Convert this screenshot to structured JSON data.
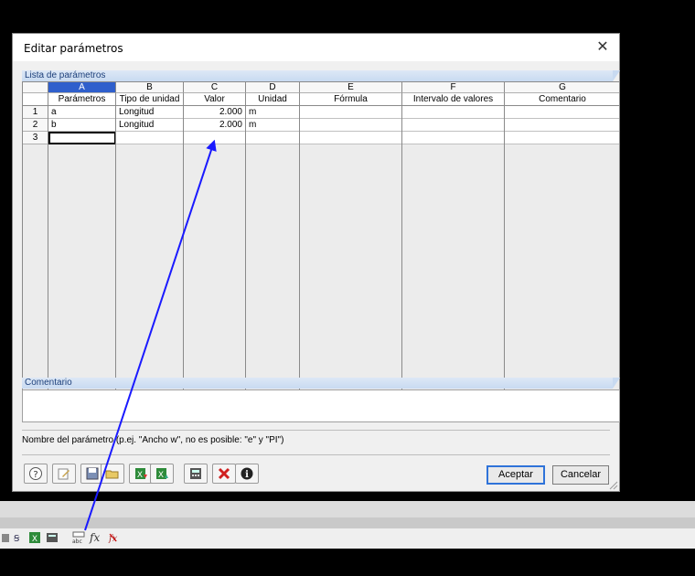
{
  "dialog": {
    "title": "Editar parámetros",
    "close_glyph": "✕",
    "list_section_label": "Lista de parámetros",
    "comment_section_label": "Comentario",
    "hint_text": "Nombre del parámetro (p.ej. \"Ancho w\", no es posible: \"e\" y \"PI\")",
    "buttons": {
      "ok": "Aceptar",
      "cancel": "Cancelar"
    }
  },
  "table": {
    "col_letters": [
      "A",
      "B",
      "C",
      "D",
      "E",
      "F",
      "G"
    ],
    "col_names": [
      "Parámetros",
      "Tipo de unidad",
      "Valor",
      "Unidad",
      "Fórmula",
      "Intervalo de valores",
      "Comentario"
    ],
    "rows": [
      {
        "num": "1",
        "param": "a",
        "type": "Longitud",
        "value": "2.000",
        "unit": "m"
      },
      {
        "num": "2",
        "param": "b",
        "type": "Longitud",
        "value": "2.000",
        "unit": "m"
      },
      {
        "num": "3",
        "param": "",
        "type": "",
        "value": "",
        "unit": ""
      }
    ]
  },
  "toolbar_icons": [
    "help-icon",
    "edit-icon",
    "save-icon",
    "open-folder-icon",
    "import-excel-icon",
    "export-excel-icon",
    "calculator-icon",
    "delete-icon",
    "info-icon"
  ],
  "taskbar_icons": [
    "formula-icon",
    "fx-icon",
    "fx-remove-icon"
  ],
  "colors": {
    "accent": "#2f5fcc",
    "arrow": "#1a1aff",
    "section_text": "#1c3f7a"
  }
}
